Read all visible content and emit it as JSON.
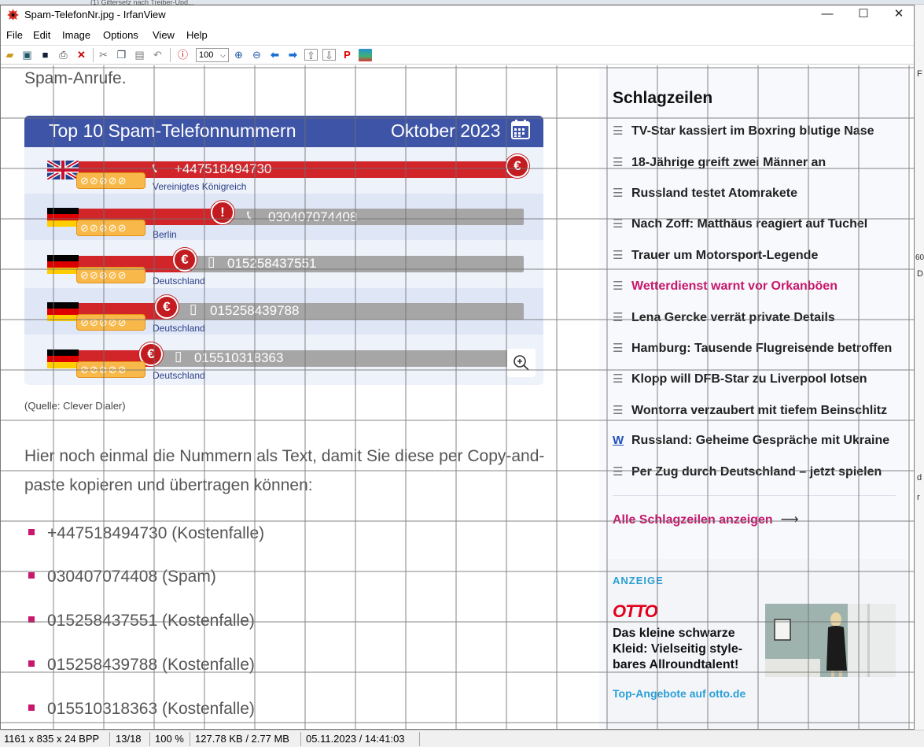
{
  "background": {
    "tab_title": "(1) Gittersetz nach Treiber-Upd...",
    "right_strip_chars": [
      "F",
      "60",
      "D",
      "d",
      "r"
    ]
  },
  "window": {
    "title": "Spam-TelefonNr.jpg - IrfanView",
    "minimize": "—",
    "maximize": "☐",
    "close": "✕"
  },
  "menu": [
    "File",
    "Edit",
    "Image",
    "Options",
    "View",
    "Help"
  ],
  "toolbar": {
    "zoom_value": "100",
    "icons": [
      "open-icon",
      "thumbnails-icon",
      "save-icon",
      "print-icon",
      "delete-icon",
      "cut-icon",
      "copy-icon",
      "paste-icon",
      "undo-icon",
      "info-icon",
      "zoom-in-icon",
      "zoom-out-icon",
      "previous-icon",
      "next-icon",
      "first-icon",
      "last-icon",
      "paypal-icon",
      "image-settings-icon"
    ]
  },
  "article": {
    "lead": "Spam-Anrufe.",
    "infographic": {
      "title": "Top 10 Spam-Telefonnummern",
      "date": "Oktober 2023",
      "rows": [
        {
          "number": "+447518494730",
          "country": "Vereinigtes Königreich",
          "coins": "⊘⊘⊘⊘⊘",
          "type": "Kostenfalle"
        },
        {
          "number": "030407074408",
          "country": "Berlin",
          "coins": "⊘⊘⊘⊘⊘",
          "type": "Spam"
        },
        {
          "number": "015258437551",
          "country": "Deutschland",
          "coins": "⊘⊘⊘⊘⊘",
          "type": "Kostenfalle"
        },
        {
          "number": "015258439788",
          "country": "Deutschland",
          "coins": "⊘⊘⊘⊘⊘",
          "type": "Kostenfalle"
        },
        {
          "number": "015510318363",
          "country": "Deutschland",
          "coins": "⊘⊘⊘⊘⊘",
          "type": "Kostenfalle"
        }
      ]
    },
    "source": "(Quelle: Clever Dialer)",
    "paragraph": "Hier noch einmal die Nummern als Text, damit Sie diese per Copy-and-paste kopieren und übertragen können:",
    "list": [
      "+447518494730 (Kostenfalle)",
      "030407074408 (Spam)",
      "015258437551 (Kostenfalle)",
      "015258439788 (Kostenfalle)",
      "015510318363 (Kostenfalle)"
    ]
  },
  "sidebar": {
    "title": "Schlagzeilen",
    "headlines": [
      "TV-Star kassiert im Boxring blutige Nase",
      "18-Jährige greift zwei Männer an",
      "Russland testet Atomrakete",
      "Nach Zoff: Matthäus reagiert auf Tuchel",
      "Trauer um Motorsport-Legende",
      "Wetterdienst warnt vor Orkanböen",
      "Lena Gercke verrät private Details",
      "Hamburg: Tausende Flugreisende betroffen",
      "Klopp will DFB-Star zu Liverpool lotsen",
      "Wontorra verzaubert mit tiefem Beinschlitz",
      "Russland: Geheime Gespräche mit Ukraine",
      "Per Zug durch Deutschland – jetzt spielen"
    ],
    "all_link": "Alle Schlagzeilen anzeigen",
    "ad": {
      "label": "ANZEIGE",
      "brand": "OTTO",
      "text": "Das kleine schwarze Kleid: Vielseitig style-bares Allroundtalent!",
      "link": "Top-Angebote auf otto.de"
    }
  },
  "status": {
    "dimensions": "1161 x 835 x 24 BPP",
    "index": "13/18",
    "zoom": "100 %",
    "size": "127.78 KB / 2.77 MB",
    "datetime": "05.11.2023 / 14:41:03"
  },
  "colors": {
    "header_blue": "#3e54a6",
    "bar_red": "#d1252a",
    "accent_pink": "#c8176c",
    "ad_blue": "#2a9fd6"
  }
}
